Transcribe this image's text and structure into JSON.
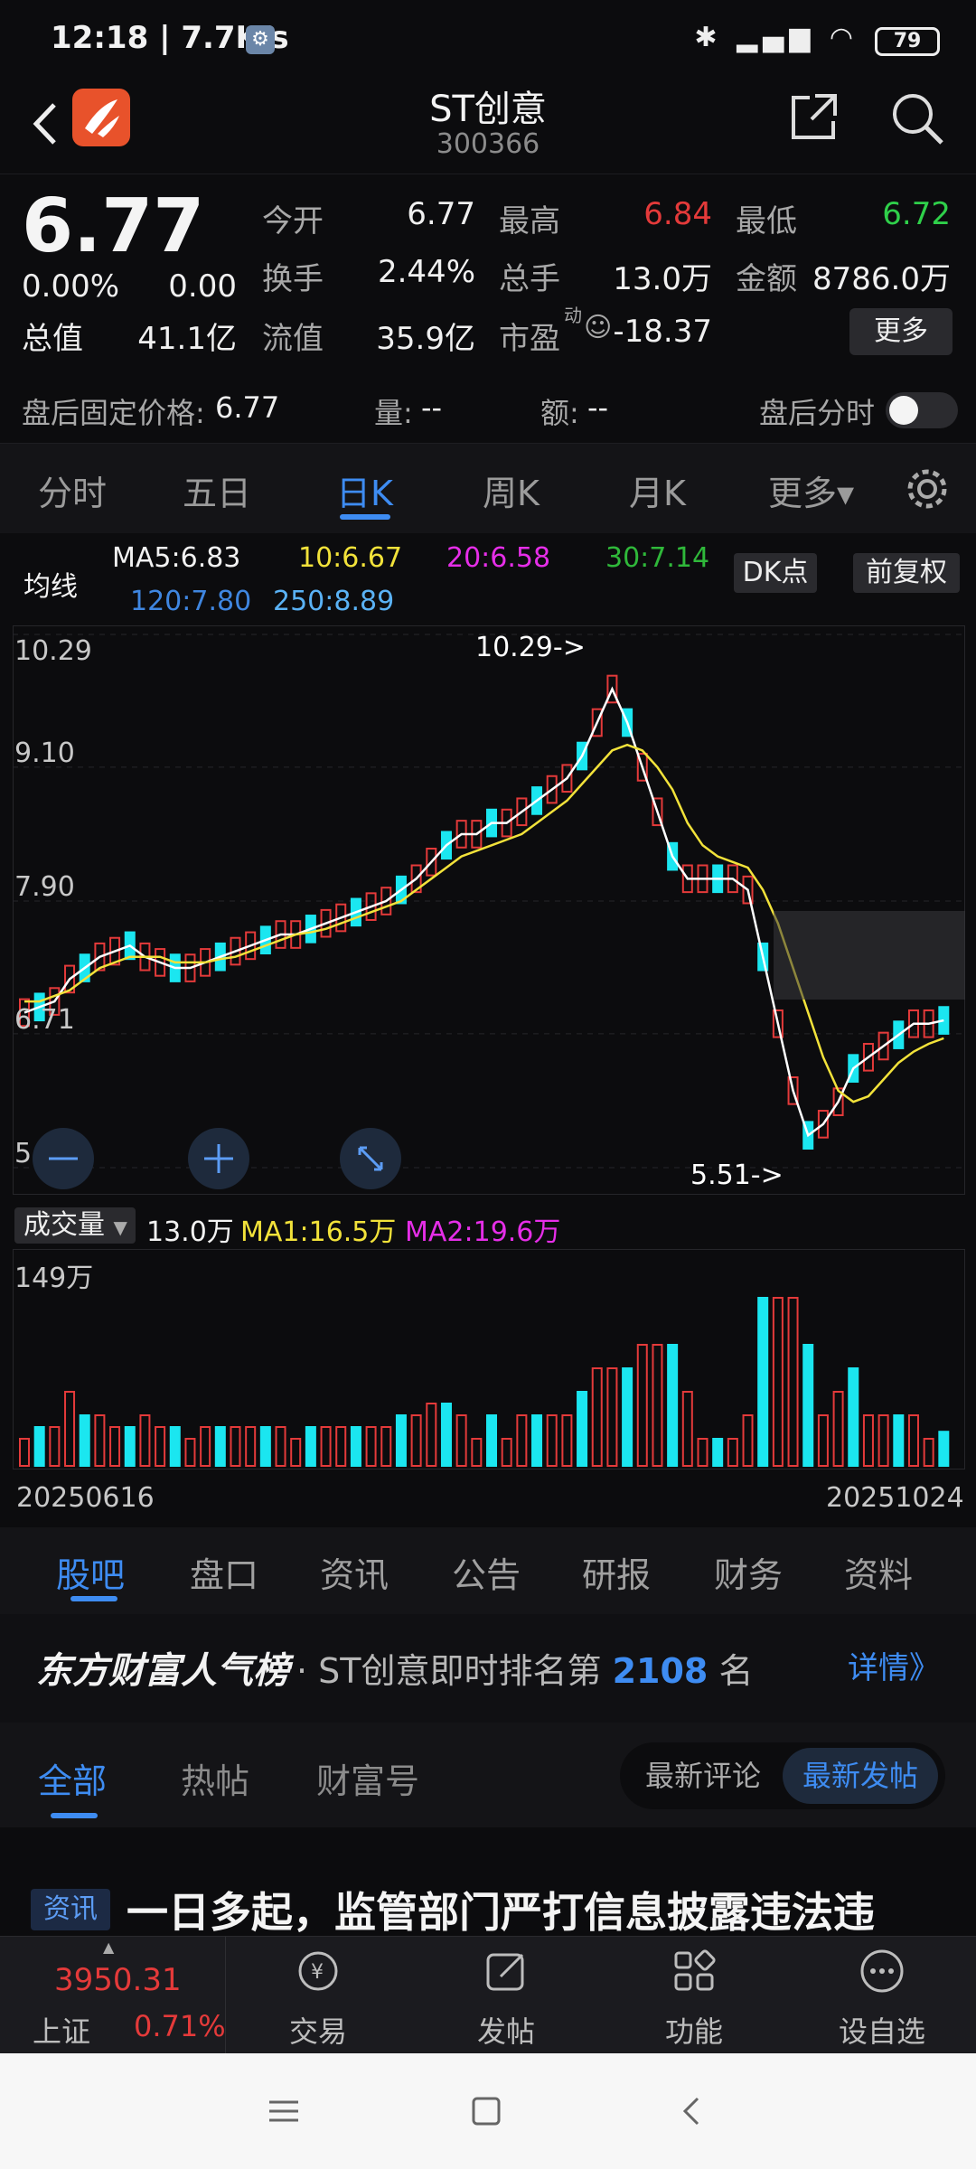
{
  "status": {
    "time": "12:18 | 7.7K/s",
    "battery": "79"
  },
  "header": {
    "title": "ST创意",
    "code": "300366"
  },
  "quote": {
    "price": "6.77",
    "change_pct": "0.00%",
    "change": "0.00",
    "open_label": "今开",
    "open": "6.77",
    "high_label": "最高",
    "high": "6.84",
    "low_label": "最低",
    "low": "6.72",
    "turnover_label": "换手",
    "turnover": "2.44%",
    "volume_label": "总手",
    "volume": "13.0万",
    "amount_label": "金额",
    "amount": "8786.0万",
    "mcap_label": "总值",
    "mcap": "41.1亿",
    "float_label": "流值",
    "float": "35.9亿",
    "pe_label": "市盈",
    "pe_sup": "动",
    "pe": "-18.37",
    "more_label": "更多"
  },
  "after_hours": {
    "price_label": "盘后固定价格:",
    "price": "6.77",
    "vol_label": "量:",
    "vol": "--",
    "amt_label": "额:",
    "amt": "--",
    "timeshare_label": "盘后分时"
  },
  "ktabs": [
    "分时",
    "五日",
    "日K",
    "周K",
    "月K",
    "更多▾"
  ],
  "active_ktab": "日K",
  "ma": {
    "title": "均线",
    "ma5": "MA5:6.83",
    "ma10": "10:6.67",
    "ma20": "20:6.58",
    "ma30": "30:7.14",
    "ma120": "120:7.80",
    "ma250": "250:8.89",
    "dk": "DK点",
    "fq": "前复权"
  },
  "colors": {
    "up": "#e43a3a",
    "down": "#1be6f0",
    "ma5": "#ffffff",
    "ma10": "#f2e23a",
    "ma20": "#e62ee8",
    "ma30": "#2fb83a",
    "ma120": "#3f86e0",
    "ma250": "#5ab2f5",
    "accent": "#3e8cf2"
  },
  "chart_data": [
    {
      "type": "candlestick",
      "title": "",
      "ylim": [
        5.51,
        10.29
      ],
      "y_ticks": [
        "10.29",
        "9.10",
        "7.90",
        "6.71",
        "5.51"
      ],
      "annotations": [
        "10.29->",
        "5.51->"
      ],
      "series": [
        {
          "name": "MA5",
          "values": [
            6.9,
            6.95,
            7.0,
            7.2,
            7.3,
            7.4,
            7.45,
            7.5,
            7.4,
            7.35,
            7.3,
            7.3,
            7.35,
            7.4,
            7.45,
            7.5,
            7.55,
            7.6,
            7.6,
            7.65,
            7.7,
            7.75,
            7.8,
            7.85,
            7.9,
            8.0,
            8.1,
            8.25,
            8.4,
            8.5,
            8.5,
            8.6,
            8.6,
            8.7,
            8.8,
            8.9,
            9.0,
            9.2,
            9.5,
            9.8,
            9.5,
            9.1,
            8.7,
            8.3,
            8.1,
            8.1,
            8.1,
            8.1,
            8.0,
            7.4,
            6.8,
            6.2,
            5.8,
            5.9,
            6.1,
            6.4,
            6.5,
            6.6,
            6.7,
            6.8,
            6.8,
            6.83
          ]
        },
        {
          "name": "MA10",
          "values": [
            7.0,
            7.0,
            7.05,
            7.1,
            7.2,
            7.3,
            7.35,
            7.4,
            7.4,
            7.4,
            7.35,
            7.35,
            7.35,
            7.38,
            7.4,
            7.45,
            7.5,
            7.55,
            7.6,
            7.62,
            7.65,
            7.7,
            7.75,
            7.8,
            7.85,
            7.9,
            8.0,
            8.1,
            8.2,
            8.3,
            8.35,
            8.4,
            8.45,
            8.5,
            8.6,
            8.7,
            8.8,
            8.95,
            9.1,
            9.25,
            9.3,
            9.25,
            9.1,
            8.9,
            8.6,
            8.4,
            8.3,
            8.25,
            8.2,
            8.0,
            7.7,
            7.3,
            6.9,
            6.5,
            6.2,
            6.1,
            6.15,
            6.3,
            6.45,
            6.55,
            6.62,
            6.67
          ]
        }
      ],
      "x_range": [
        "20250616",
        "20251024"
      ]
    },
    {
      "type": "bar",
      "title": "成交量",
      "readout": {
        "vol": "13.0万",
        "ma1": "MA1:16.5万",
        "ma2": "MA2:19.6万"
      },
      "y_max_label": "149万",
      "x_range": [
        "20250616",
        "20251024"
      ]
    }
  ],
  "subtabs": [
    "股吧",
    "盘口",
    "资讯",
    "公告",
    "研报",
    "财务",
    "资料"
  ],
  "rank": {
    "brand": "东方财富人气榜",
    "prefix": "· ST创意即时排名第",
    "number": "2108",
    "suffix": "名",
    "detail": "详情》"
  },
  "feed_tabs": [
    "全部",
    "热帖",
    "财富号"
  ],
  "sort": {
    "a": "最新评论",
    "b": "最新发帖"
  },
  "news": {
    "tag": "资讯",
    "title": "一日多起，监管部门严打信息披露违法违"
  },
  "bottom": {
    "index_value": "3950.31",
    "index_name": "上证",
    "index_pct": "0.71%",
    "trade": "交易",
    "post": "发帖",
    "func": "功能",
    "watch": "设自选"
  }
}
